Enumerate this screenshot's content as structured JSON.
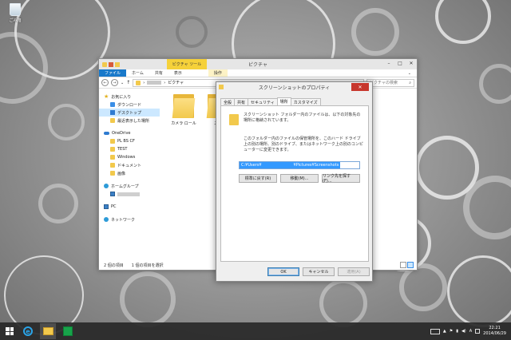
{
  "desktop": {
    "recycle_bin_label": "ごみ箱"
  },
  "explorer": {
    "title": "ピクチャ",
    "contextual_tab": "ピクチャ ツール",
    "ribbon_tabs": [
      "ファイル",
      "ホーム",
      "共有",
      "表示",
      "操作"
    ],
    "address_path": "ピクチャ",
    "search_placeholder": "ピクチャの検索",
    "nav": {
      "favorites": "お気に入り",
      "downloads": "ダウンロード",
      "desktop": "デスクトップ",
      "recent": "最近表示した場所",
      "onedrive": "OneDrive",
      "od_item1": "PL BS CF",
      "od_item2": "TEST",
      "od_item3": "Windows",
      "od_item4": "ドキュメント",
      "od_item5": "画像",
      "homegroup": "ホームグループ",
      "pc": "PC",
      "network": "ネットワーク"
    },
    "folders": [
      {
        "label": "カメラ ロール"
      },
      {
        "label": "スク"
      }
    ],
    "status": {
      "items": "2 個の項目",
      "selected": "1 個の項目を選択"
    }
  },
  "dialog": {
    "title": "スクリーンショットのプロパティ",
    "close_glyph": "✕",
    "tabs": [
      "全般",
      "共有",
      "セキュリティ",
      "場所",
      "カスタマイズ"
    ],
    "description1": "スクリーンショット フォルダー内のファイルは、以下の対象先の場所に格納されています。",
    "description2": "このフォルダー内のファイルの保管場所を、このハード ドライブ上の別の場所、別のドライブ、またはネットワーク上の別のコンピューターに変更できます。",
    "path_prefix": "C:¥Users¥",
    "path_suffix": "¥Pictures¥Screenshots",
    "buttons": {
      "restore": "標準に戻す(R)",
      "move": "移動(M)...",
      "find_target": "リンク先を探す(F)...",
      "ok": "OK",
      "cancel": "キャンセル",
      "apply": "適用(A)"
    }
  },
  "taskbar": {
    "time": "22:21",
    "date": "2014/06/29",
    "ime": "A"
  }
}
